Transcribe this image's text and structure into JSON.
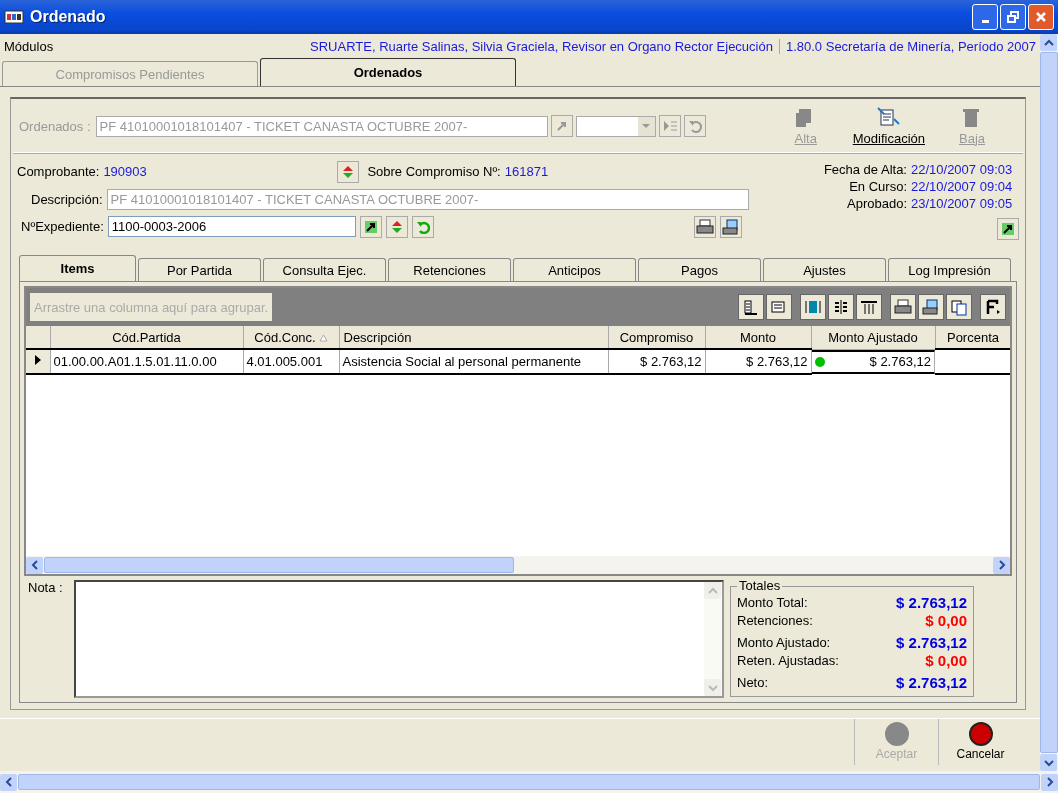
{
  "window": {
    "title": "Ordenado"
  },
  "header": {
    "modules_label": "Módulos",
    "user_info": "SRUARTE, Ruarte Salinas, Silvia Graciela, Revisor en Organo Rector Ejecución",
    "version_info": "1.80.0 Secretaría de Minería, Período 2007"
  },
  "main_tabs": [
    {
      "label": "Compromisos Pendientes",
      "selected": false
    },
    {
      "label": "Ordenados",
      "selected": true
    }
  ],
  "ordenados": {
    "label": "Ordenados :",
    "value": "PF 41010001018101407 - TICKET CANASTA OCTUBRE 2007-",
    "disabled": true
  },
  "toolbar_buttons": [
    {
      "label": "Alta",
      "kind": "add",
      "disabled": true
    },
    {
      "label": "Modificación",
      "kind": "edit",
      "disabled": false
    },
    {
      "label": "Baja",
      "kind": "delete",
      "disabled": true
    }
  ],
  "comprobante": {
    "label": "Comprobante:",
    "value": "190903"
  },
  "sobre_compromiso": {
    "label": "Sobre Compromiso Nº:",
    "value": "161871"
  },
  "fechas": [
    {
      "label": "Fecha de Alta:",
      "value": "22/10/2007 09:03"
    },
    {
      "label": "En Curso:",
      "value": "22/10/2007 09:04"
    },
    {
      "label": "Aprobado:",
      "value": "23/10/2007 09:05"
    }
  ],
  "descripcion": {
    "label": "Descripción:",
    "value": "PF 41010001018101407 - TICKET CANASTA OCTUBRE 2007-"
  },
  "expediente": {
    "label": "NºExpediente:",
    "value": "1100-0003-2006"
  },
  "detail_tabs": [
    {
      "label": "Items",
      "selected": true
    },
    {
      "label": "Por Partida",
      "selected": false
    },
    {
      "label": "Consulta Ejec.",
      "selected": false
    },
    {
      "label": "Retenciones",
      "selected": false
    },
    {
      "label": "Anticipos",
      "selected": false
    },
    {
      "label": "Pagos",
      "selected": false
    },
    {
      "label": "Ajustes",
      "selected": false
    },
    {
      "label": "Log Impresión",
      "selected": false
    }
  ],
  "grid": {
    "group_placeholder": "Arrastre una columna aquí para agrupar.",
    "columns": [
      {
        "label": "Cód.Partida",
        "sorted": false
      },
      {
        "label": "Cód.Conc.",
        "sorted": true
      },
      {
        "label": "Descripción",
        "sorted": false
      },
      {
        "label": "Compromiso",
        "sorted": false
      },
      {
        "label": "Monto",
        "sorted": false
      },
      {
        "label": "Monto Ajustado",
        "sorted": false
      },
      {
        "label": "Porcenta",
        "sorted": false
      }
    ],
    "rows": [
      {
        "selected": true,
        "color": "#00c000",
        "cells": [
          "01.00.00.A01.1.5.01.11.0.00",
          "4.01.005.001",
          "Asistencia Social al personal permanente",
          "$ 2.763,12",
          "$ 2.763,12",
          "$ 2.763,12"
        ]
      }
    ]
  },
  "nota": {
    "label": "Nota :"
  },
  "totales": {
    "title": "Totales",
    "rows": [
      {
        "label": "Monto Total:",
        "value": "$ 2.763,12",
        "kind": "positive"
      },
      {
        "label": "Retenciones:",
        "value": "$ 0,00",
        "kind": "negative"
      },
      {
        "label": "Monto Ajustado:",
        "value": "$ 2.763,12",
        "kind": "positive"
      },
      {
        "label": "Reten. Ajustadas:",
        "value": "$ 0,00",
        "kind": "negative"
      },
      {
        "label": "Neto:",
        "value": "$ 2.763,12",
        "kind": "positive"
      }
    ]
  },
  "footer_buttons": [
    {
      "label": "Aceptar",
      "kind": "accept",
      "disabled": true
    },
    {
      "label": "Cancelar",
      "kind": "cancel",
      "disabled": false
    }
  ]
}
